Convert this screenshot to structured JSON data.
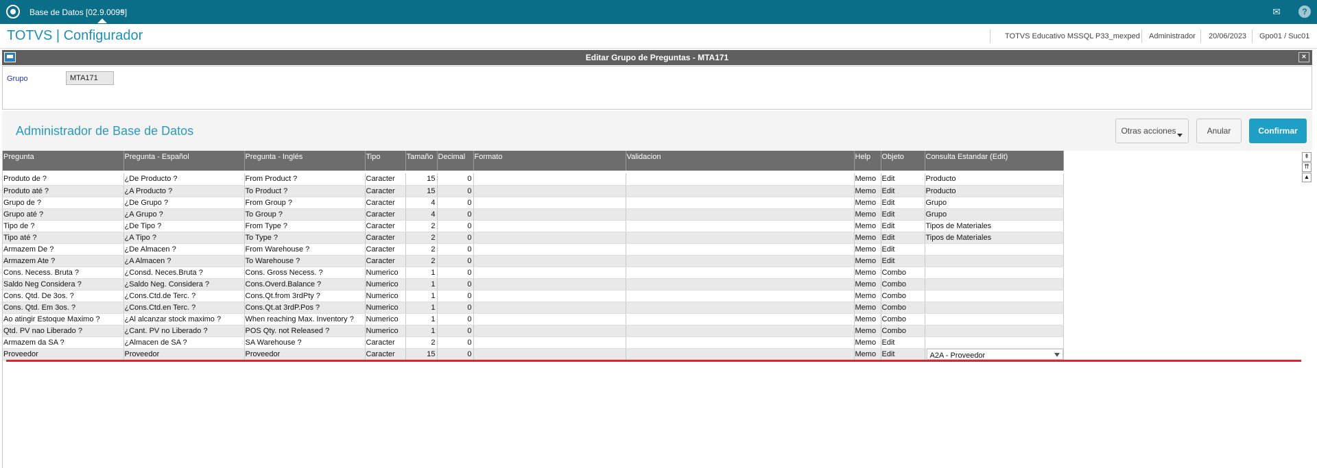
{
  "topbar": {
    "tab_label": "Base de Datos [02.9.0099]",
    "tab_close": "×",
    "icons": [
      "app-logo-icon",
      "mail-icon",
      "help-icon"
    ],
    "help_glyph": "?",
    "mail_glyph": "✉"
  },
  "header": {
    "title": "TOTVS | Configurador",
    "environment": "TOTVS Educativo MSSQL P33_mexped",
    "user": "Administrador",
    "date": "20/06/2023",
    "branch": "Gpo01 / Suc01"
  },
  "dialog": {
    "title": "Editar Grupo de Preguntas - MTA171",
    "close_glyph": "×"
  },
  "group": {
    "label": "Grupo",
    "value": "MTA171"
  },
  "section": {
    "title": "Administrador de Base de Datos",
    "btn_otras": "Otras acciones",
    "btn_anular": "Anular",
    "btn_confirmar": "Confirmar"
  },
  "grid": {
    "columns": [
      "Pregunta",
      "Pregunta - Español",
      "Pregunta - Inglés",
      "Tipo",
      "Tamaño",
      "Decimal",
      "Formato",
      "Validacion",
      "Help",
      "Objeto",
      "Consulta Estandar (Edit)"
    ],
    "rows": [
      [
        "Produto de ?",
        "¿De Producto ?",
        "From Product ?",
        "Caracter",
        "15",
        "0",
        "",
        "",
        "Memo",
        "Edit",
        "Producto"
      ],
      [
        "Produto até ?",
        "¿A Producto ?",
        "To Product ?",
        "Caracter",
        "15",
        "0",
        "",
        "",
        "Memo",
        "Edit",
        "Producto"
      ],
      [
        "Grupo de ?",
        "¿De Grupo ?",
        "From Group ?",
        "Caracter",
        "4",
        "0",
        "",
        "",
        "Memo",
        "Edit",
        "Grupo"
      ],
      [
        "Grupo até ?",
        "¿A Grupo ?",
        "To Group ?",
        "Caracter",
        "4",
        "0",
        "",
        "",
        "Memo",
        "Edit",
        "Grupo"
      ],
      [
        "Tipo de ?",
        "¿De Tipo ?",
        "From Type ?",
        "Caracter",
        "2",
        "0",
        "",
        "",
        "Memo",
        "Edit",
        "Tipos de Materiales"
      ],
      [
        "Tipo até ?",
        "¿A Tipo ?",
        "To Type ?",
        "Caracter",
        "2",
        "0",
        "",
        "",
        "Memo",
        "Edit",
        "Tipos de Materiales"
      ],
      [
        "Armazem De ?",
        "¿De Almacen ?",
        "From Warehouse ?",
        "Caracter",
        "2",
        "0",
        "",
        "",
        "Memo",
        "Edit",
        ""
      ],
      [
        "Armazem Ate ?",
        "¿A Almacen ?",
        "To Warehouse ?",
        "Caracter",
        "2",
        "0",
        "",
        "",
        "Memo",
        "Edit",
        ""
      ],
      [
        "Cons. Necess. Bruta ?",
        "¿Consd. Neces.Bruta ?",
        "Cons. Gross Necess. ?",
        "Numerico",
        "1",
        "0",
        "",
        "",
        "Memo",
        "Combo",
        ""
      ],
      [
        "Saldo Neg Considera ?",
        "¿Saldo Neg. Considera ?",
        "Cons.Overd.Balance ?",
        "Numerico",
        "1",
        "0",
        "",
        "",
        "Memo",
        "Combo",
        ""
      ],
      [
        "Cons. Qtd. De 3os. ?",
        "¿Cons.Ctd.de Terc. ?",
        "Cons.Qt.from 3rdPty ?",
        "Numerico",
        "1",
        "0",
        "",
        "",
        "Memo",
        "Combo",
        ""
      ],
      [
        "Cons. Qtd. Em 3os. ?",
        "¿Cons.Ctd.en Terc. ?",
        "Cons.Qt.at 3rdP.Pos ?",
        "Numerico",
        "1",
        "0",
        "",
        "",
        "Memo",
        "Combo",
        ""
      ],
      [
        "Ao atingir Estoque Maximo ?",
        "¿Al alcanzar stock maximo ?",
        "When reaching Max. Inventory ?",
        "Numerico",
        "1",
        "0",
        "",
        "",
        "Memo",
        "Combo",
        ""
      ],
      [
        "Qtd. PV nao Liberado ?",
        "¿Cant. PV no Liberado ?",
        "POS Qty. not Released ?",
        "Numerico",
        "1",
        "0",
        "",
        "",
        "Memo",
        "Combo",
        ""
      ],
      [
        "Armazem da SA ?",
        "¿Almacen de SA ?",
        "SA Warehouse ?",
        "Caracter",
        "2",
        "0",
        "",
        "",
        "Memo",
        "Edit",
        ""
      ],
      [
        "Proveedor",
        "Proveedor",
        "Proveedor",
        "Caracter",
        "15",
        "0",
        "",
        "",
        "Memo",
        "Edit",
        "A2A - Proveedor"
      ]
    ]
  },
  "scroll_glyphs": [
    "⇞",
    "⇈",
    "▲"
  ]
}
